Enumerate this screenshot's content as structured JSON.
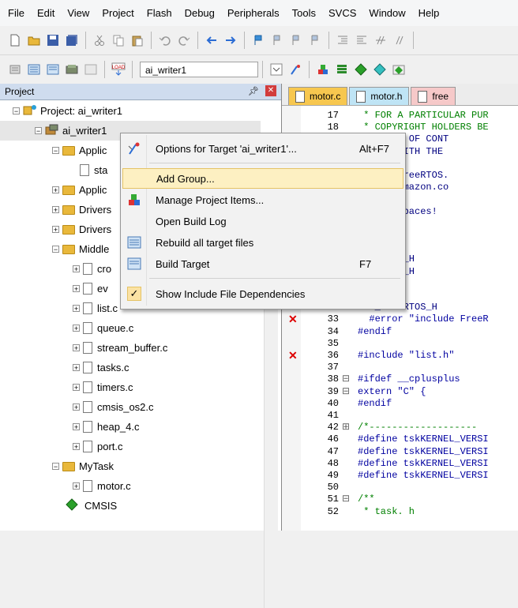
{
  "menubar": [
    "File",
    "Edit",
    "View",
    "Project",
    "Flash",
    "Debug",
    "Peripherals",
    "Tools",
    "SVCS",
    "Window",
    "Help"
  ],
  "toolbar": {
    "target_name": "ai_writer1"
  },
  "project_panel": {
    "title": "Project",
    "tree": [
      {
        "label": "Project: ai_writer1",
        "kind": "project",
        "exp": "−"
      },
      {
        "label": "ai_writer1",
        "kind": "target",
        "exp": "−"
      },
      {
        "label": "Applic",
        "kind": "folder",
        "exp": "−"
      },
      {
        "label": "sta",
        "kind": "file",
        "exp": ""
      },
      {
        "label": "Applic",
        "kind": "folder",
        "exp": "+"
      },
      {
        "label": "Drivers",
        "kind": "folder",
        "exp": "+"
      },
      {
        "label": "Drivers",
        "kind": "folder",
        "exp": "+"
      },
      {
        "label": "Middle",
        "kind": "folder",
        "exp": "−"
      },
      {
        "label": "cro",
        "kind": "file",
        "exp": "+"
      },
      {
        "label": "ev",
        "kind": "file",
        "exp": "+"
      },
      {
        "label": "list.c",
        "kind": "file",
        "exp": "+"
      },
      {
        "label": "queue.c",
        "kind": "file",
        "exp": "+"
      },
      {
        "label": "stream_buffer.c",
        "kind": "file",
        "exp": "+"
      },
      {
        "label": "tasks.c",
        "kind": "file",
        "exp": "+"
      },
      {
        "label": "timers.c",
        "kind": "file",
        "exp": "+"
      },
      {
        "label": "cmsis_os2.c",
        "kind": "file",
        "exp": "+"
      },
      {
        "label": "heap_4.c",
        "kind": "file",
        "exp": "+"
      },
      {
        "label": "port.c",
        "kind": "file",
        "exp": "+"
      },
      {
        "label": "MyTask",
        "kind": "folder",
        "exp": "−"
      },
      {
        "label": "motor.c",
        "kind": "file",
        "exp": "+"
      },
      {
        "label": "CMSIS",
        "kind": "cmsis",
        "exp": ""
      }
    ]
  },
  "editor": {
    "tabs": [
      "motor.c",
      "motor.h",
      "free"
    ],
    "lines": [
      {
        "n": "17",
        "t": " * FOR A PARTICULAR PUR",
        "f": ""
      },
      {
        "n": "18",
        "t": " * COPYRIGHT HOLDERS BE",
        "f": ""
      },
      {
        "n": "",
        "t": "N ACTION OF CONT",
        "f": ""
      },
      {
        "n": "",
        "t": "ECTION WITH THE",
        "f": ""
      },
      {
        "n": "",
        "t": "",
        "f": ""
      },
      {
        "n": "",
        "t": " //www.FreeRTOS.",
        "f": ""
      },
      {
        "n": "",
        "t": " //aws.amazon.co",
        "f": ""
      },
      {
        "n": "",
        "t": "",
        "f": ""
      },
      {
        "n": "",
        "t": "b == 4 spaces!",
        "f": ""
      },
      {
        "n": "",
        "t": "",
        "f": ""
      },
      {
        "n": "",
        "t": "",
        "f": ""
      },
      {
        "n": "",
        "t": "",
        "f": ""
      },
      {
        "n": "",
        "t": "INC_TASK_H",
        "f": ""
      },
      {
        "n": "",
        "t": "INC_TASK_H",
        "f": ""
      },
      {
        "n": "",
        "t": "",
        "f": ""
      },
      {
        "n": "",
        "t": "",
        "f": ""
      },
      {
        "n": "",
        "t": "INC_FREERTOS_H",
        "f": ""
      },
      {
        "n": "33",
        "t": "  #error \"include FreeR",
        "f": ""
      },
      {
        "n": "34",
        "t": "#endif",
        "f": ""
      },
      {
        "n": "35",
        "t": "",
        "f": ""
      },
      {
        "n": "36",
        "t": "#include \"list.h\"",
        "f": ""
      },
      {
        "n": "37",
        "t": "",
        "f": ""
      },
      {
        "n": "38",
        "t": "#ifdef __cplusplus",
        "f": "⊟"
      },
      {
        "n": "39",
        "t": "extern \"C\" {",
        "f": "⊟"
      },
      {
        "n": "40",
        "t": "#endif",
        "f": ""
      },
      {
        "n": "41",
        "t": "",
        "f": ""
      },
      {
        "n": "42",
        "t": "/*-------------------",
        "f": "⊞"
      },
      {
        "n": "46",
        "t": "#define tskKERNEL_VERSI",
        "f": ""
      },
      {
        "n": "47",
        "t": "#define tskKERNEL_VERSI",
        "f": ""
      },
      {
        "n": "48",
        "t": "#define tskKERNEL_VERSI",
        "f": ""
      },
      {
        "n": "49",
        "t": "#define tskKERNEL_VERSI",
        "f": ""
      },
      {
        "n": "50",
        "t": "",
        "f": ""
      },
      {
        "n": "51",
        "t": "/**",
        "f": "⊟"
      },
      {
        "n": "52",
        "t": " * task. h",
        "f": ""
      }
    ]
  },
  "context_menu": {
    "items": [
      {
        "label": "Options for Target 'ai_writer1'...",
        "shortcut": "Alt+F7"
      },
      {
        "label": "Add Group...",
        "shortcut": ""
      },
      {
        "label": "Manage Project Items...",
        "shortcut": ""
      },
      {
        "label": "Open Build Log",
        "shortcut": ""
      },
      {
        "label": "Rebuild all target files",
        "shortcut": ""
      },
      {
        "label": "Build Target",
        "shortcut": "F7"
      },
      {
        "label": "Show Include File Dependencies",
        "shortcut": ""
      }
    ]
  }
}
